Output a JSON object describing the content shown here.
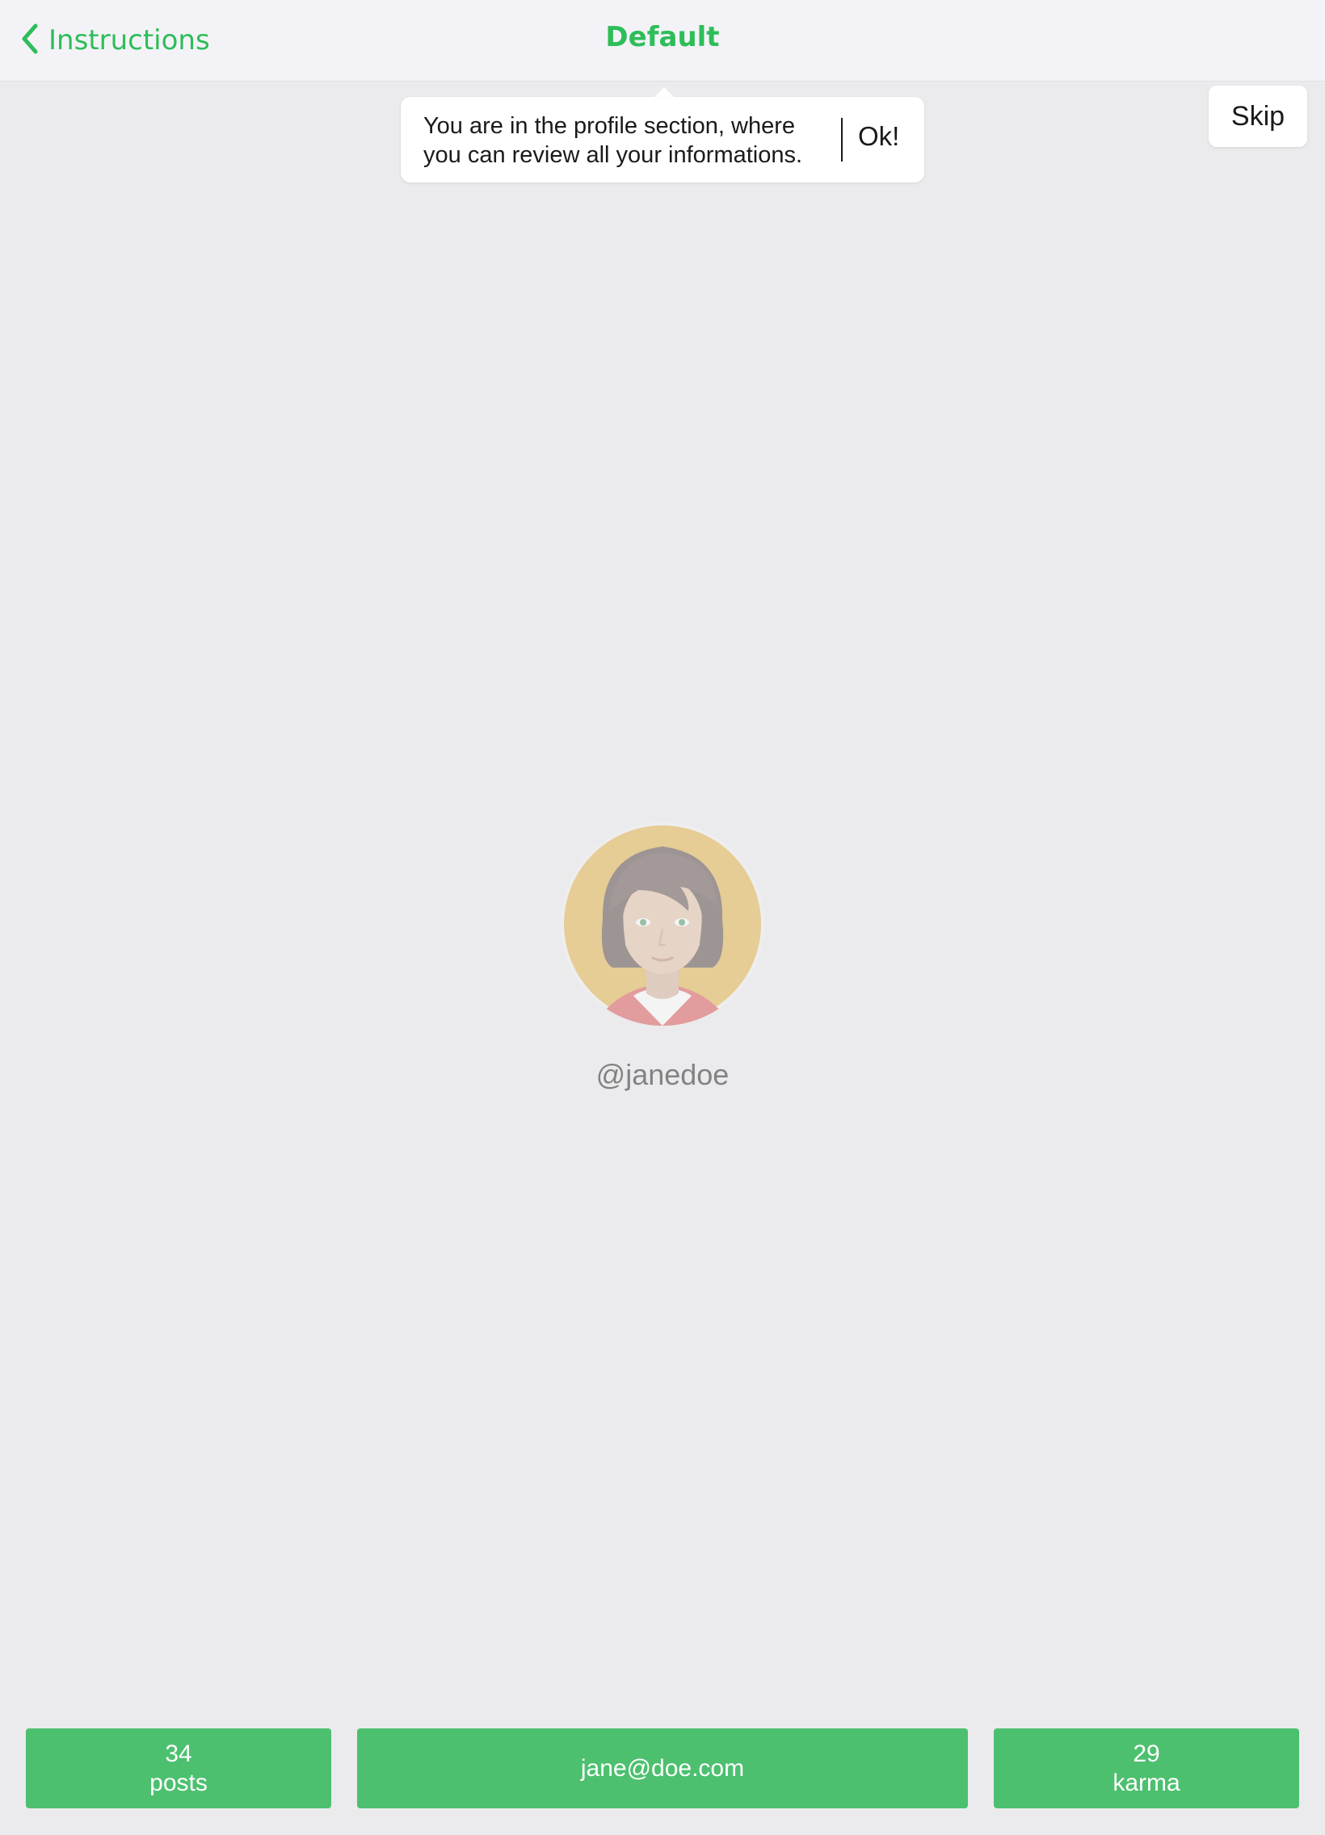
{
  "nav": {
    "back_label": "Instructions",
    "title": "Default"
  },
  "profile": {
    "username": "@janedoe",
    "avatar_icon": "user-avatar-icon"
  },
  "stats": {
    "posts_count": "34",
    "posts_label": "posts",
    "email": "jane@doe.com",
    "karma_count": "29",
    "karma_label": "karma"
  },
  "tooltip": {
    "line1": "You are in the profile section, where",
    "line2": "you can review all your informations.",
    "ok_label": "Ok!"
  },
  "skip_label": "Skip",
  "colors": {
    "accent": "#2ebd59",
    "background": "#ebebed",
    "stat_button": "#a8dbb6"
  }
}
